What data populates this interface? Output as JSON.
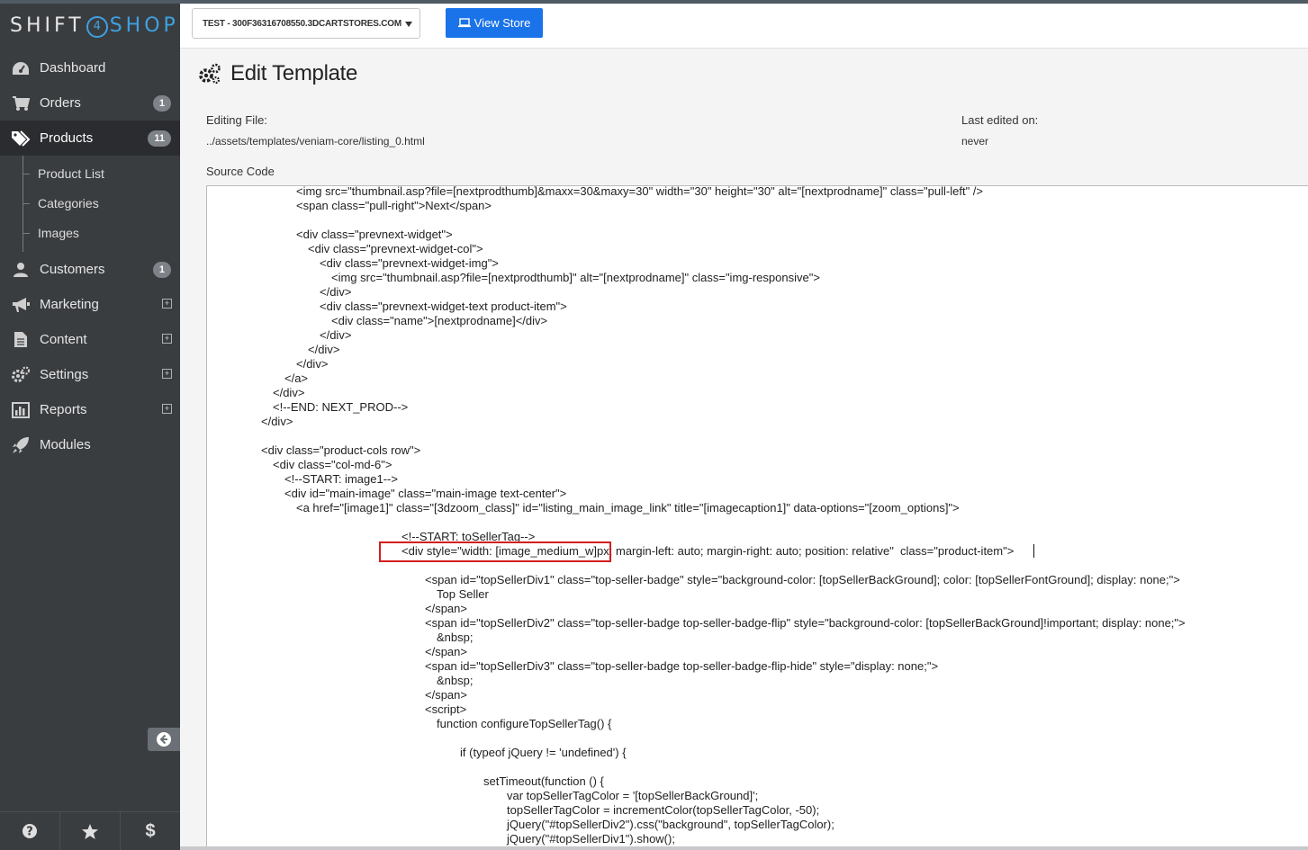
{
  "brand": {
    "left": "SHIFT",
    "num": "4",
    "right": "SHOP"
  },
  "sidebar": {
    "items": [
      {
        "label": "Dashboard",
        "icon": "dashboard-icon"
      },
      {
        "label": "Orders",
        "icon": "cart-icon",
        "badge": "1"
      },
      {
        "label": "Products",
        "icon": "tags-icon",
        "badge": "11",
        "active": true
      },
      {
        "label": "Customers",
        "icon": "user-icon",
        "badge": "1"
      },
      {
        "label": "Marketing",
        "icon": "bullhorn-icon",
        "expand": "⊞"
      },
      {
        "label": "Content",
        "icon": "document-icon",
        "expand": "⊞"
      },
      {
        "label": "Settings",
        "icon": "gears-icon",
        "expand": "⊞"
      },
      {
        "label": "Reports",
        "icon": "bar-chart-icon",
        "expand": "⊞"
      },
      {
        "label": "Modules",
        "icon": "rocket-icon"
      }
    ],
    "sub_items": [
      "Product List",
      "Categories",
      "Images"
    ],
    "bottom": [
      "help-icon",
      "star-icon",
      "dollar-icon"
    ]
  },
  "topbar": {
    "store": "TEST - 300F36316708550.3DCARTSTORES.COM",
    "view_store": "View Store"
  },
  "page": {
    "title": "Edit Template",
    "editing_file_label": "Editing File:",
    "editing_file_value": "../assets/templates/veniam-core/listing_0.html",
    "last_edited_label": "Last edited on:",
    "last_edited_value": "never",
    "source_code_label": "Source Code"
  },
  "code": "\t\t\t\t\t\t\t<img src=\"thumbnail.asp?file=[nextprodthumb]&maxx=30&maxy=30\" width=\"30\" height=\"30\" alt=\"[nextprodname]\" class=\"pull-left\" />\n\t\t\t\t\t\t\t<span class=\"pull-right\">Next</span>\n\n\t\t\t\t\t\t\t<div class=\"prevnext-widget\">\n\t\t\t\t\t\t\t\t<div class=\"prevnext-widget-col\">\n\t\t\t\t\t\t\t\t\t<div class=\"prevnext-widget-img\">\n\t\t\t\t\t\t\t\t\t\t<img src=\"thumbnail.asp?file=[nextprodthumb]\" alt=\"[nextprodname]\" class=\"img-responsive\">\n\t\t\t\t\t\t\t\t\t</div>\n\t\t\t\t\t\t\t\t\t<div class=\"prevnext-widget-text product-item\">\n\t\t\t\t\t\t\t\t\t\t<div class=\"name\">[nextprodname]</div>\n\t\t\t\t\t\t\t\t\t</div>\n\t\t\t\t\t\t\t\t</div>\n\t\t\t\t\t\t\t</div>\n\t\t\t\t\t\t</a>\n\t\t\t\t\t</div>\n\t\t\t\t\t<!--END: NEXT_PROD-->\n\t\t\t\t</div>\n\n\t\t\t\t<div class=\"product-cols row\">\n\t\t\t\t\t<div class=\"col-md-6\">\n\t\t\t\t\t\t<!--START: image1-->\n\t\t\t\t\t\t<div id=\"main-image\" class=\"main-image text-center\">\n\t\t\t\t\t\t\t<a href=\"[image1]\" class=\"[3dzoom_class]\" id=\"listing_main_image_link\" title=\"[imagecaption1]\" data-options=\"[zoom_options]\">\n\n\t\t\t\t\t\t\t\t\t\t\t\t\t\t\t\t<!--START: toSellerTag-->\n\t\t\t\t\t\t\t\t\t\t\t\t\t\t\t\t<div style=\"width: [image_medium_w]px; margin-left: auto; margin-right: auto; position: relative\"  class=\"product-item\">\n\n\t\t\t\t\t\t\t\t\t\t\t\t\t\t\t\t\t\t<span id=\"topSellerDiv1\" class=\"top-seller-badge\" style=\"background-color: [topSellerBackGround]; color: [topSellerFontGround]; display: none;\">\n\t\t\t\t\t\t\t\t\t\t\t\t\t\t\t\t\t\t\tTop Seller\n\t\t\t\t\t\t\t\t\t\t\t\t\t\t\t\t\t\t</span>\n\t\t\t\t\t\t\t\t\t\t\t\t\t\t\t\t\t\t<span id=\"topSellerDiv2\" class=\"top-seller-badge top-seller-badge-flip\" style=\"background-color: [topSellerBackGround]!important; display: none;\">\n\t\t\t\t\t\t\t\t\t\t\t\t\t\t\t\t\t\t\t&nbsp;\n\t\t\t\t\t\t\t\t\t\t\t\t\t\t\t\t\t\t</span>\n\t\t\t\t\t\t\t\t\t\t\t\t\t\t\t\t\t\t<span id=\"topSellerDiv3\" class=\"top-seller-badge top-seller-badge-flip-hide\" style=\"display: none;\">\n\t\t\t\t\t\t\t\t\t\t\t\t\t\t\t\t\t\t\t&nbsp;\n\t\t\t\t\t\t\t\t\t\t\t\t\t\t\t\t\t\t</span>\n\t\t\t\t\t\t\t\t\t\t\t\t\t\t\t\t\t\t<script>\n\t\t\t\t\t\t\t\t\t\t\t\t\t\t\t\t\t\t\tfunction configureTopSellerTag() {\n\n\t\t\t\t\t\t\t\t\t\t\t\t\t\t\t\t\t\t\t\t\tif (typeof jQuery != 'undefined') {\n\n\t\t\t\t\t\t\t\t\t\t\t\t\t\t\t\t\t\t\t\t\t\t\tsetTimeout(function () {\n\t\t\t\t\t\t\t\t\t\t\t\t\t\t\t\t\t\t\t\t\t\t\t\t\tvar topSellerTagColor = '[topSellerBackGround]';\n\t\t\t\t\t\t\t\t\t\t\t\t\t\t\t\t\t\t\t\t\t\t\t\t\ttopSellerTagColor = incrementColor(topSellerTagColor, -50);\n\t\t\t\t\t\t\t\t\t\t\t\t\t\t\t\t\t\t\t\t\t\t\t\t\tjQuery(\"#topSellerDiv2\").css(\"background\", topSellerTagColor);\n\t\t\t\t\t\t\t\t\t\t\t\t\t\t\t\t\t\t\t\t\t\t\t\t\tjQuery(\"#topSellerDiv1\").show();"
}
